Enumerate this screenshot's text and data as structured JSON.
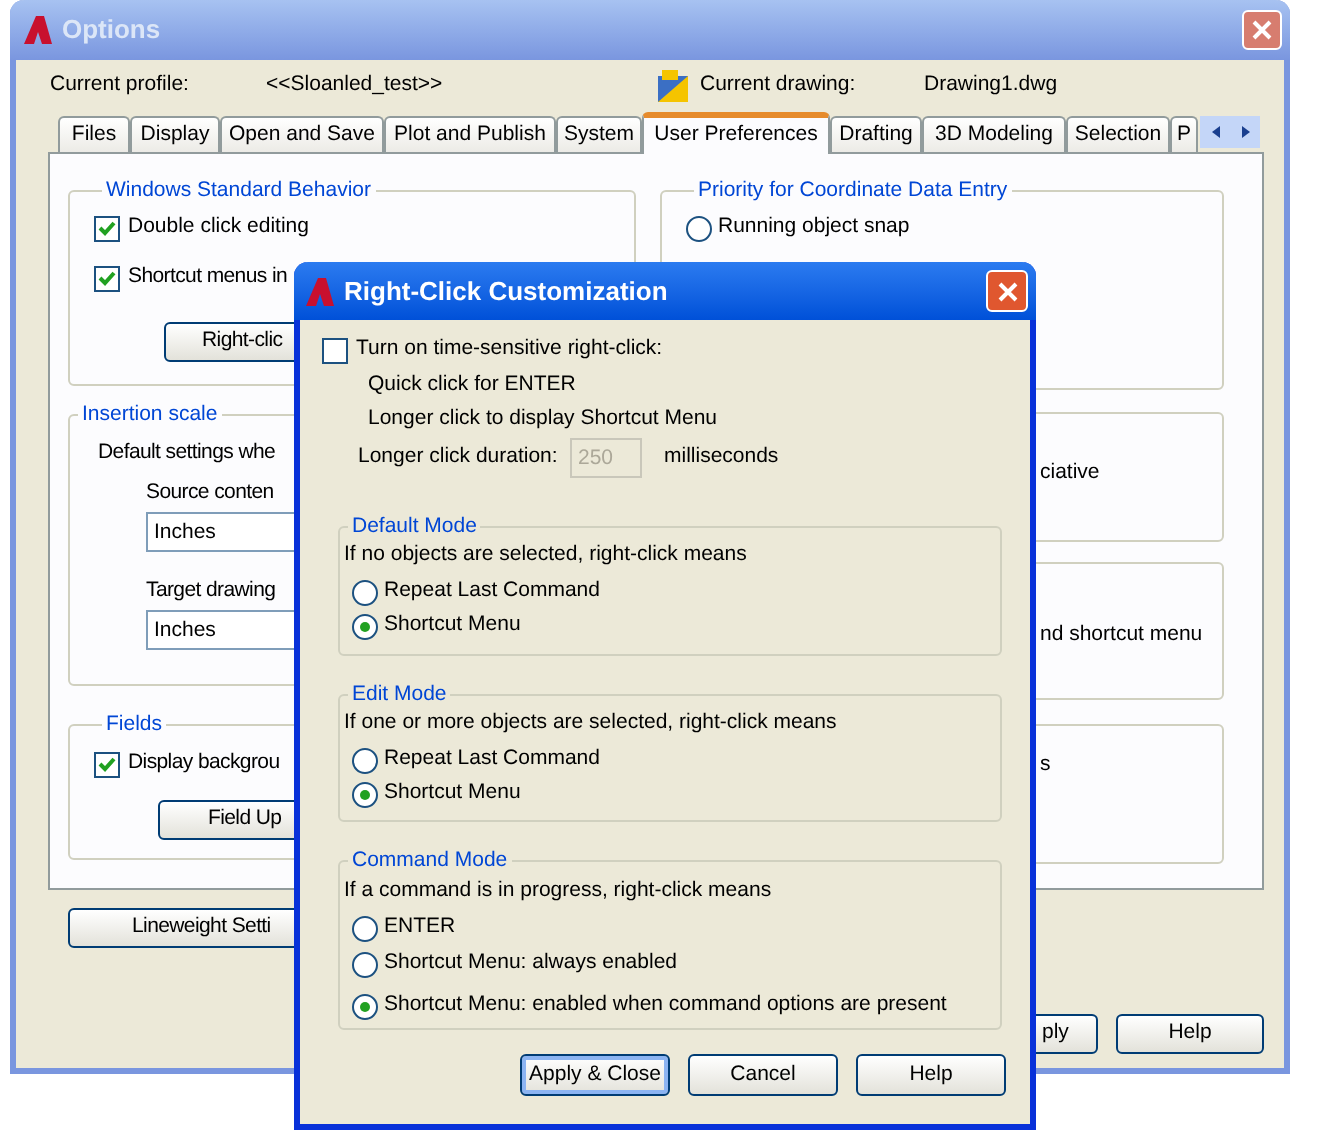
{
  "options_window": {
    "title": "Options",
    "current_profile_label": "Current profile:",
    "current_profile": "<<Sloanled_test>>",
    "current_drawing_label": "Current drawing:",
    "current_drawing": "Drawing1.dwg",
    "tabs": [
      {
        "label": "Files",
        "selected": false
      },
      {
        "label": "Display",
        "selected": false
      },
      {
        "label": "Open and Save",
        "selected": false
      },
      {
        "label": "Plot and Publish",
        "selected": false
      },
      {
        "label": "System",
        "selected": false
      },
      {
        "label": "User Preferences",
        "selected": true
      },
      {
        "label": "Drafting",
        "selected": false
      },
      {
        "label": "3D Modeling",
        "selected": false
      },
      {
        "label": "Selection",
        "selected": false
      },
      {
        "label": "P",
        "selected": false
      }
    ],
    "windows_standard_behavior": {
      "title": "Windows Standard Behavior",
      "items": [
        {
          "label": "Double click editing",
          "checked": true
        },
        {
          "label": "Shortcut menus in",
          "checked": true
        }
      ],
      "button": "Right-clic"
    },
    "insertion_scale": {
      "title": "Insertion scale",
      "description": "Default settings whe",
      "source_label": "Source conten",
      "source_value": "Inches",
      "target_label": "Target drawing",
      "target_value": "Inches"
    },
    "fields": {
      "title": "Fields",
      "checkbox": {
        "label": "Display backgrou",
        "checked": true
      },
      "button": "Field Up"
    },
    "lineweight_button": "Lineweight Setti",
    "coordinate_priority": {
      "title": "Priority for Coordinate Data Entry",
      "options": [
        {
          "label": "Running object snap",
          "selected": false
        }
      ]
    },
    "side_groups": [
      {
        "text": "ciative"
      },
      {
        "text": "nd shortcut menu"
      },
      {
        "text": "s"
      }
    ],
    "buttons": [
      "ply",
      "Help"
    ]
  },
  "dialog": {
    "title": "Right-Click Customization",
    "time_sensitive": {
      "label": "Turn on time-sensitive right-click:",
      "checked": false
    },
    "notes": [
      "Quick click for ENTER",
      "Longer click to display Shortcut Menu"
    ],
    "duration_label": "Longer click duration:",
    "duration_value": "250",
    "duration_disabled": true,
    "duration_unit": "milliseconds",
    "modes": [
      {
        "title": "Default Mode",
        "description": "If no objects are selected, right-click means",
        "options": [
          {
            "label": "Repeat Last Command",
            "selected": false
          },
          {
            "label": "Shortcut Menu",
            "selected": true
          }
        ]
      },
      {
        "title": "Edit Mode",
        "description": "If one or more objects are selected, right-click means",
        "options": [
          {
            "label": "Repeat Last Command",
            "selected": false
          },
          {
            "label": "Shortcut Menu",
            "selected": true
          }
        ]
      },
      {
        "title": "Command Mode",
        "description": "If a command is in progress, right-click means",
        "options": [
          {
            "label": "ENTER",
            "selected": false
          },
          {
            "label": "Shortcut Menu: always enabled",
            "selected": false
          },
          {
            "label": "Shortcut Menu: enabled when command options are present",
            "selected": true
          }
        ]
      }
    ],
    "buttons": [
      {
        "label": "Apply & Close",
        "focused": true
      },
      {
        "label": "Cancel",
        "focused": false
      },
      {
        "label": "Help",
        "focused": false
      }
    ]
  }
}
